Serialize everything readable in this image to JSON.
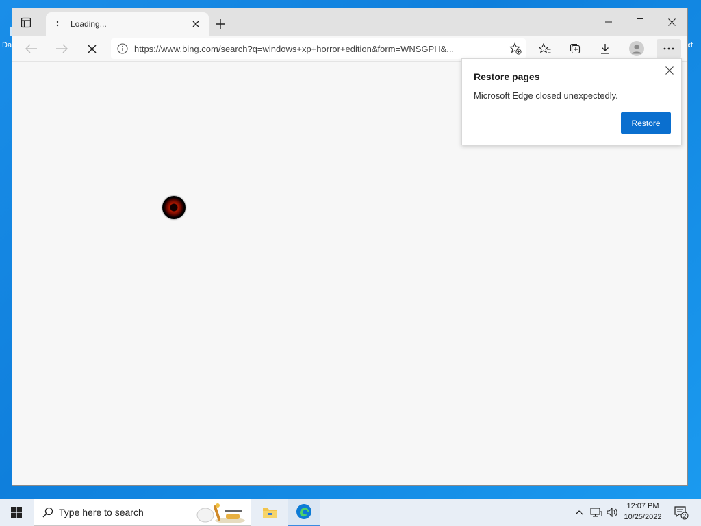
{
  "desktop": {
    "left_fragment": "Da",
    "right_fragment": "xt"
  },
  "tab": {
    "title": "Loading..."
  },
  "address": {
    "url": "https://www.bing.com/search?q=windows+xp+horror+edition&form=WNSGPH&..."
  },
  "popup": {
    "title": "Restore pages",
    "message": "Microsoft Edge closed unexpectedly.",
    "button": "Restore"
  },
  "taskbar": {
    "search_placeholder": "Type here to search",
    "time": "12:07 PM",
    "date": "10/25/2022",
    "notification_count": "2"
  },
  "colors": {
    "accent": "#0a6fcf",
    "desktop": "#1a8ee8"
  }
}
